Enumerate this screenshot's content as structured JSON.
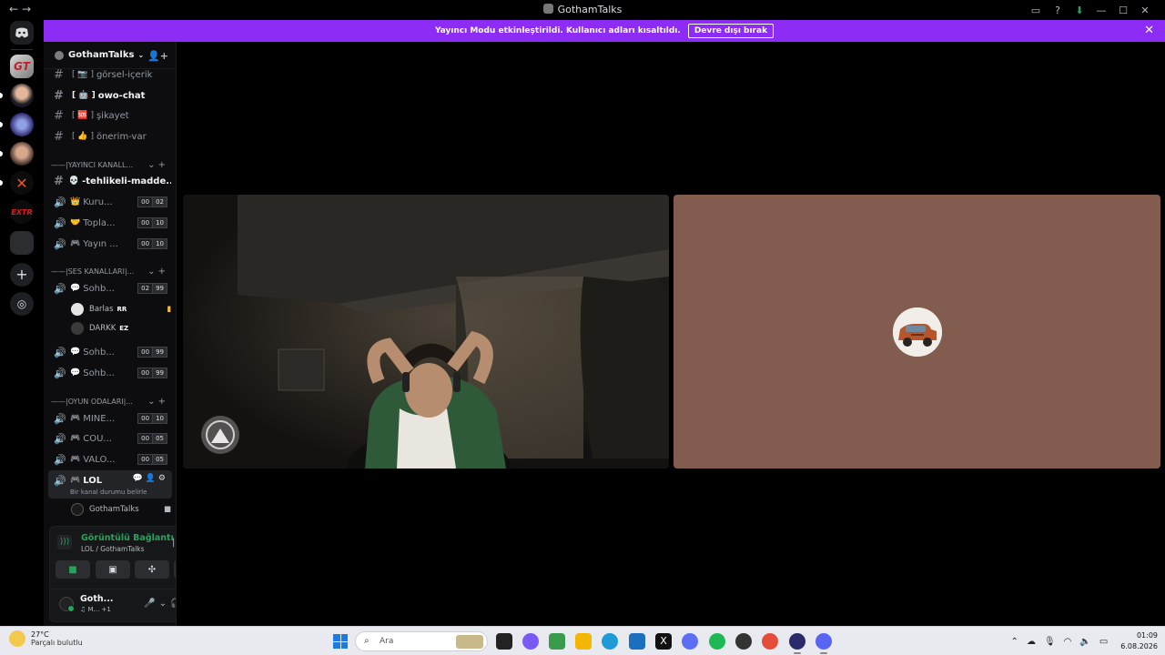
{
  "window": {
    "title": "GothamTalks"
  },
  "banner": {
    "message": "Yayıncı Modu etkinleştirildi. Kullanıcı adları kısaltıldı.",
    "button": "Devre dışı bırak"
  },
  "server": {
    "name": "GothamTalks"
  },
  "channels": [
    {
      "kind": "text",
      "emoji": "[ 📷 ]",
      "name": "görsel-içerik"
    },
    {
      "kind": "text",
      "emoji": "[ 🤖 ]",
      "name": "owo-chat"
    },
    {
      "kind": "text",
      "emoji": "[ 🆘 ]",
      "name": "şikayet"
    },
    {
      "kind": "text",
      "emoji": "[ 👍 ]",
      "name": "önerim-var"
    }
  ],
  "categories": {
    "streamer": "|YAYINCI KANALL...",
    "voice": "|SES KANALLARI|...",
    "games": "|OYUN ODALARI|..."
  },
  "streamer_channels": {
    "text": {
      "emoji": "💀",
      "name": "-tehlikeli-madde..."
    },
    "voice": [
      {
        "emoji": "👑",
        "name": "Kuru...",
        "count": "00",
        "limit": "02"
      },
      {
        "emoji": "🤝",
        "name": "Topla...",
        "count": "00",
        "limit": "10"
      },
      {
        "emoji": "🎮",
        "name": "Yayın ...",
        "count": "00",
        "limit": "10"
      }
    ]
  },
  "voice_channels": [
    {
      "emoji": "💬",
      "name": "Sohb...",
      "count": "02",
      "limit": "99"
    },
    {
      "emoji": "💬",
      "name": "Sohb...",
      "count": "00",
      "limit": "99"
    },
    {
      "emoji": "💬",
      "name": "Sohb...",
      "count": "00",
      "limit": "99"
    }
  ],
  "voice_members": [
    {
      "name": "Barlas",
      "tag": "RR"
    },
    {
      "name": "DARKK",
      "tag": "EZ"
    }
  ],
  "game_channels": [
    {
      "emoji": "🎮",
      "name": "MINE...",
      "count": "00",
      "limit": "10"
    },
    {
      "emoji": "🎮",
      "name": "COU...",
      "count": "00",
      "limit": "05"
    },
    {
      "emoji": "🎮",
      "name": "VALO...",
      "count": "00",
      "limit": "05"
    },
    {
      "emoji": "🎮",
      "name": "LOL",
      "status": "Bir kanal durumu belirle"
    }
  ],
  "lol_member": {
    "name": "GothamTalks"
  },
  "voice_panel": {
    "title": "Görüntülü Bağlantı",
    "subtitle": "LOL / GothamTalks"
  },
  "user_panel": {
    "name": "Goth...",
    "status": "M...",
    "extra": "+1"
  },
  "taskbar": {
    "weather_temp": "27°C",
    "weather_desc": "Parçalı bulutlu",
    "search_placeholder": "Ara",
    "time": "01:09",
    "date": "6.08.2026"
  },
  "colors": {
    "banner": "#8c2cf5",
    "connected": "#23a55a",
    "avatar_tile": "#825c4f"
  }
}
